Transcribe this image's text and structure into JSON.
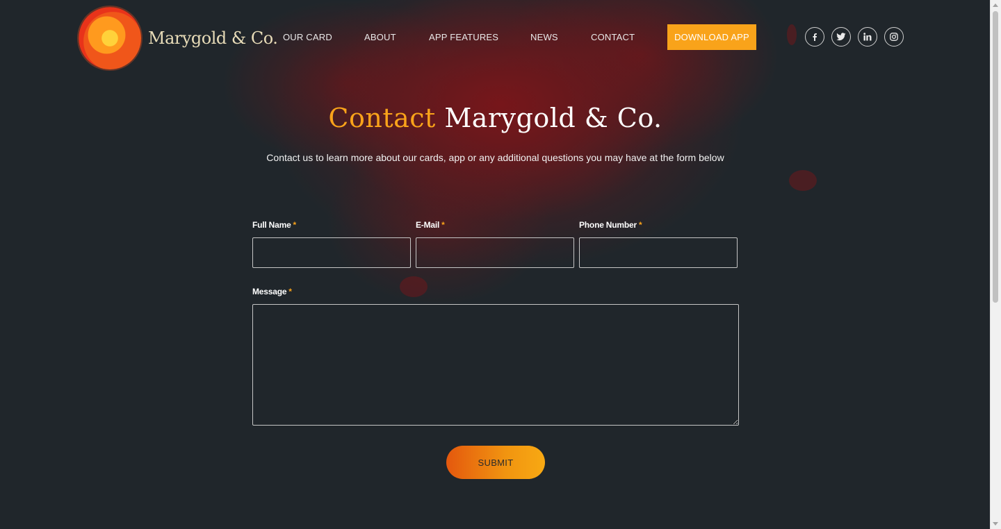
{
  "brand": {
    "name": "Marygold & Co."
  },
  "nav": {
    "items": [
      {
        "label": "OUR CARD"
      },
      {
        "label": "ABOUT"
      },
      {
        "label": "APP FEATURES"
      },
      {
        "label": "NEWS"
      },
      {
        "label": "CONTACT"
      }
    ],
    "cta_label": "DOWNLOAD APP"
  },
  "social": {
    "icons": [
      "facebook-icon",
      "twitter-icon",
      "linkedin-icon",
      "instagram-icon"
    ]
  },
  "hero": {
    "title_accent": "Contact",
    "title_rest": " Marygold & Co.",
    "subtitle": "Contact us to learn more about our cards, app or any additional questions you may have at the form below"
  },
  "form": {
    "required_marker": "*",
    "full_name": {
      "label": "Full Name",
      "value": ""
    },
    "email": {
      "label": "E-Mail",
      "value": ""
    },
    "phone": {
      "label": "Phone Number",
      "value": ""
    },
    "message": {
      "label": "Message",
      "value": ""
    },
    "submit_label": "SUBMIT"
  },
  "colors": {
    "background": "#20262b",
    "accent": "#f9a31a",
    "splash": "#7a1a1e"
  }
}
